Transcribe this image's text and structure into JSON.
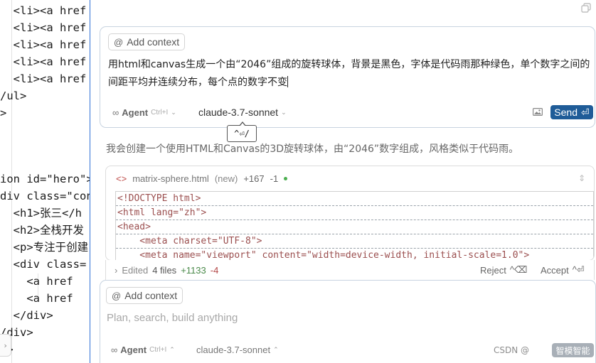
{
  "editor": {
    "lines": [
      "  <li><a href",
      "  <li><a href",
      "  <li><a href",
      "  <li><a href",
      "  <li><a href",
      "/ul>",
      ">",
      "",
      "",
      "ion id=\"hero\">",
      "div class=\"con",
      "  <h1>张三</h",
      "  <h2>全栈开发",
      "  <p>专注于创建",
      "  <div class=",
      "    <a href",
      "    <a href",
      "  </div>",
      "/div>",
      "n>"
    ]
  },
  "prompt_card": {
    "add_context": "Add context",
    "text": "用html和canvas生成一个由“2046”组成的旋转球体，背景是黑色，字体是代码雨那种绿色，单个数字之间的间距平均并连续分布，每个点的数字不变",
    "agent_label": "Agent",
    "agent_shortcut": "Ctrl+I",
    "model": "claude-3.7-sonnet",
    "send_label": "Send",
    "send_shortcut": "⏎"
  },
  "tooltip": "^⏎/",
  "reply": "我会创建一个使用HTML和Canvas的3D旋转球体，由“2046”数字组成，风格类似于代码雨。",
  "file_card": {
    "file_name": "matrix-sphere.html",
    "status": "(new)",
    "added": "+167",
    "removed": "-1",
    "code": [
      "<!DOCTYPE html>",
      "<html lang=\"zh\">",
      "<head>",
      "    <meta charset=\"UTF-8\">",
      "    <meta name=\"viewport\" content=\"width=device-width, initial-scale=1.0\">"
    ]
  },
  "edited_bar": {
    "label": "Edited",
    "files": "4 files",
    "added": "+1133",
    "removed": "-4",
    "reject": "Reject",
    "reject_shortcut": "^⌫",
    "accept": "Accept",
    "accept_shortcut": "^⏎"
  },
  "composer": {
    "add_context": "Add context",
    "placeholder": "Plan, search, build anything",
    "agent_label": "Agent",
    "agent_shortcut": "Ctrl+I",
    "model": "claude-3.7-sonnet"
  },
  "watermark": {
    "left": "CSDN @",
    "badge": "智模智能"
  },
  "colors": {
    "send": "#1f5c98",
    "card_border": "#c7d3e0",
    "added": "#4a8a4a",
    "removed": "#b34747"
  }
}
